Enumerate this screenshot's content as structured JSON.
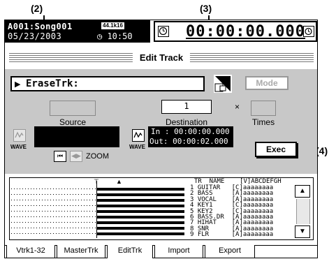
{
  "callouts": {
    "c2": "(2)",
    "c3": "(3)",
    "c4": "(4)"
  },
  "header": {
    "song": "A001:Song001",
    "date": "05/23/2003",
    "badge": "44.1k16",
    "clock": "10:50",
    "timecode": "00:00:00.000"
  },
  "title": "Edit Track",
  "function": {
    "arrow": "▶",
    "name": "EraseTrk:",
    "mode_label": "Mode"
  },
  "source": {
    "label": "Source"
  },
  "destination": {
    "value": "1",
    "label": "Destination"
  },
  "times": {
    "x": "×",
    "label": "Times"
  },
  "wave": {
    "label": "WAVE"
  },
  "zoom": {
    "label": "ZOOM",
    "btn_left": "⏮",
    "btn_right": "◀▶"
  },
  "inout": {
    "in": "In : 00:00:00.000",
    "out": "Out: 00:00:02.000"
  },
  "exec_label": "Exec",
  "tracklist": {
    "header": "TR  NAME    [V]ABCDEFGH",
    "rows": [
      "1 GUITAR   [C]aaaaaaaa",
      "2 BASS     [A]aaaaaaaa",
      "3 VOCAL    [A]aaaaaaaa",
      "4 KEY1     [C]aaaaaaaa",
      "5 KEY2     [C]aaaaaaaa",
      "6 BASS.DR  [A]aaaaaaaa",
      "7 HIHAT    [A]aaaaaaaa",
      "8 SNR      [A]aaaaaaaa",
      "9 FLR      [A]aaaaaaaa"
    ],
    "scroll_up": "▲",
    "scroll_down": "▼"
  },
  "tabs": [
    "Vtrk1-32",
    "MasterTrk",
    "EditTrk",
    "Import",
    "Export"
  ],
  "active_tab": "EditTrk"
}
